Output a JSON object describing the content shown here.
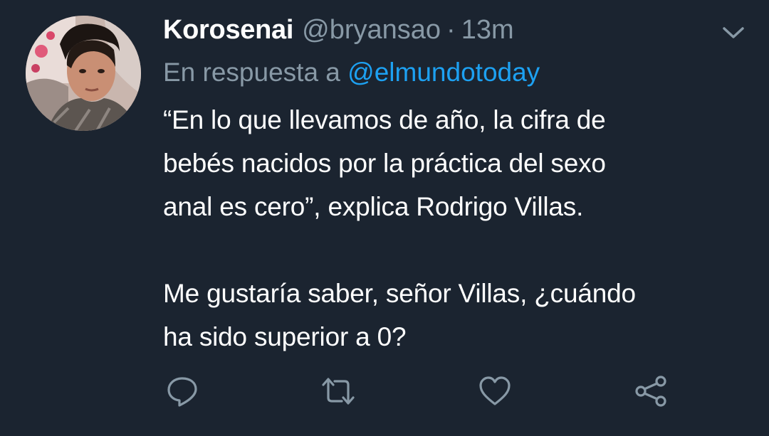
{
  "tweet": {
    "display_name": "Korosenai",
    "handle": "@bryansao",
    "separator": "·",
    "time": "13m",
    "reply_prefix": "En respuesta a",
    "reply_mention": "@elmundotoday",
    "paragraphs": [
      "“En lo que llevamos de año, la cifra de\nbebés nacidos por la práctica del sexo\nanal es cero”, explica Rodrigo Villas.",
      "Me gustaría saber, señor Villas, ¿cuándo\nha sido superior a 0?"
    ]
  },
  "icons": {
    "more": "chevron-down-icon",
    "reply": "reply-icon",
    "retweet": "retweet-icon",
    "like": "heart-icon",
    "share": "share-icon"
  },
  "colors": {
    "background": "#1b2430",
    "text": "#ffffff",
    "secondary_text": "#8899a6",
    "link": "#1da1f2",
    "icon": "#8899a6"
  }
}
